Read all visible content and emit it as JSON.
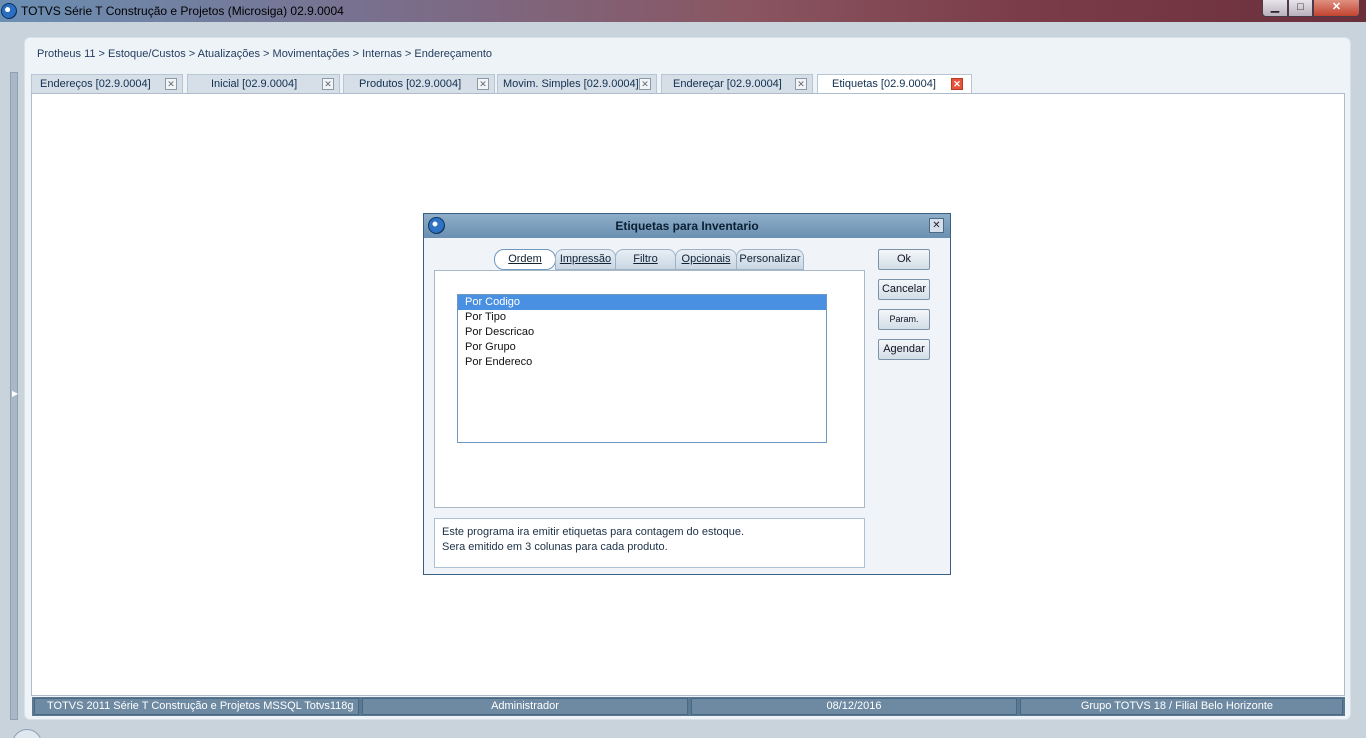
{
  "window": {
    "title": "TOTVS Série T Construção e Projetos (Microsiga) 02.9.0004",
    "controls": {
      "minimize": "▁",
      "maximize": "□",
      "close": "✕"
    }
  },
  "breadcrumb": "Protheus 11 > Estoque/Custos > Atualizações > Movimentações > Internas > Endereçamento",
  "tabs": [
    {
      "label": "Endereços [02.9.0004]"
    },
    {
      "label": "Inicial [02.9.0004]"
    },
    {
      "label": "Produtos [02.9.0004]"
    },
    {
      "label": "Movim. Simples [02.9.0004]"
    },
    {
      "label": "Endereçar [02.9.0004]"
    },
    {
      "label": "Etiquetas [02.9.0004]"
    }
  ],
  "tab_close_glyph": "✕",
  "dialog": {
    "title": "Etiquetas para Inventario",
    "close_glyph": "✕",
    "tabs": [
      {
        "label": "Ordem"
      },
      {
        "label": "Impressão"
      },
      {
        "label": "Filtro"
      },
      {
        "label": "Opcionais"
      },
      {
        "label": "Personalizar"
      }
    ],
    "order_options": [
      "Por Codigo",
      "Por Tipo",
      "Por Descricao",
      "Por Grupo",
      "Por Endereco"
    ],
    "selected_order": "Por Codigo",
    "buttons": {
      "ok": "Ok",
      "cancel": "Cancelar",
      "params": "Param.",
      "schedule": "Agendar"
    },
    "description": [
      "Este programa ira emitir etiquetas para contagem do estoque.",
      "Sera emitido em 3 colunas para cada produto."
    ]
  },
  "status": {
    "system": "TOTVS 2011 Série T Construção e Projetos MSSQL Totvs118g",
    "user": "Administrador",
    "date": "08/12/2016",
    "branch": "Grupo TOTVS 18 / Filial Belo Horizonte"
  },
  "colors": {
    "active_tab_close": "#e6553a",
    "selection": "#4a90e2",
    "statusbar": "#5a7a94"
  }
}
